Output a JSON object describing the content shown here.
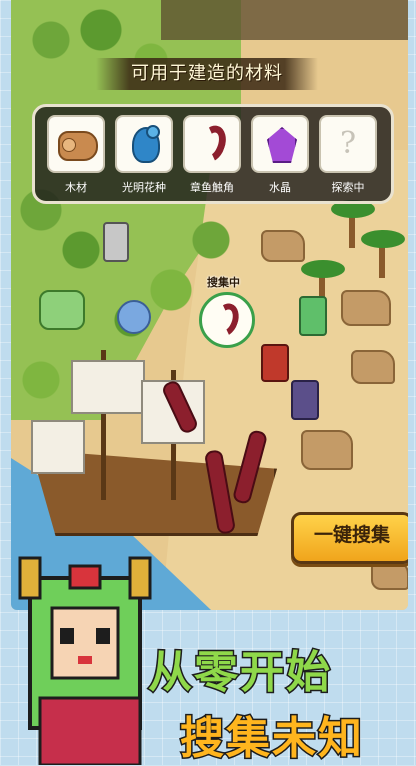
{
  "panel": {
    "title": "可用于建造的材料",
    "materials": [
      {
        "label": "木材",
        "icon": "wood-log-icon"
      },
      {
        "label": "光明花种",
        "icon": "blue-bird-seed-icon"
      },
      {
        "label": "章鱼触角",
        "icon": "tentacle-icon"
      },
      {
        "label": "水晶",
        "icon": "crystal-icon"
      },
      {
        "label": "探索中",
        "icon": "unknown-icon",
        "glyph": "?"
      }
    ]
  },
  "map": {
    "search_status": "搜集中"
  },
  "actions": {
    "collect_all": "一键搜集"
  },
  "promo": {
    "line1": "从零开始",
    "line2": "搜集未知"
  },
  "colors": {
    "accent_button": "#f0a51c",
    "slogan_green": "#8fd84a",
    "slogan_orange": "#ffb51e",
    "panel_bg": "#201e1c"
  }
}
